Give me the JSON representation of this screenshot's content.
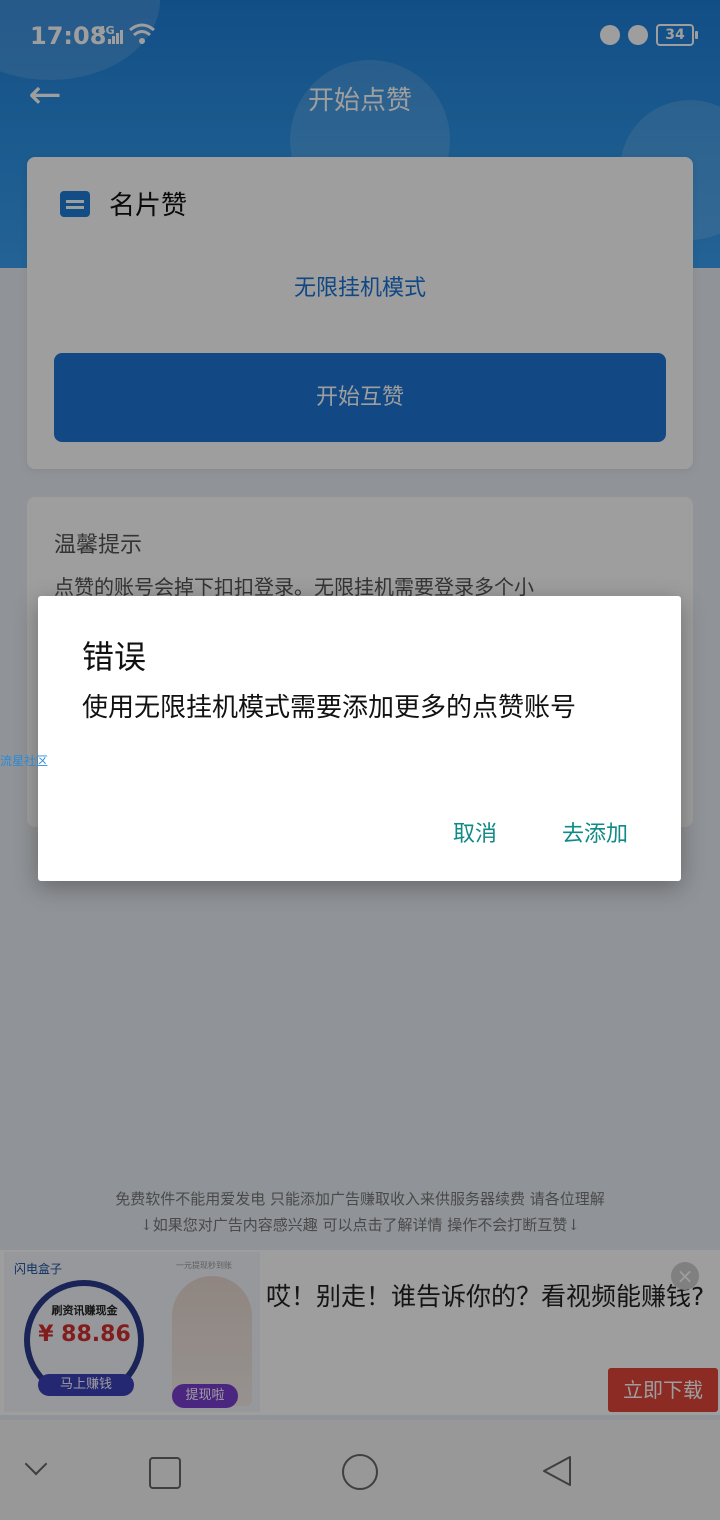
{
  "status_bar": {
    "time": "17:08",
    "network": "4G",
    "battery": "34"
  },
  "header": {
    "title": "开始点赞"
  },
  "card": {
    "title": "名片赞",
    "mode": "无限挂机模式",
    "start_button": "开始互赞"
  },
  "tips": {
    "title": "温馨提示",
    "text": "点赞的账号会掉下扣扣登录。无限挂机需要登录多个小"
  },
  "watermark": "流星社区",
  "footer_note": {
    "line1": "免费软件不能用爱发电 只能添加广告赚取收入来供服务器续费 请各位理解",
    "line2": "↓如果您对广告内容感兴趣 可以点击了解详情 操作不会打断互赞↓"
  },
  "ad": {
    "brand": "闪电盒子",
    "sub": "一元提现秒到账",
    "gauge_label": "刷资讯赚现金",
    "gauge_value": "¥ 88.86",
    "cta_pill": "马上赚钱",
    "person_button": "提现啦",
    "headline": "哎！别走！谁告诉你的？看视频能赚钱?",
    "download_button": "立即下载",
    "close": "×"
  },
  "dialog": {
    "title": "错误",
    "message": "使用无限挂机模式需要添加更多的点赞账号",
    "cancel": "取消",
    "confirm": "去添加"
  },
  "colors": {
    "primary": "#1d77d6",
    "dialog_button": "#0f8a86",
    "ad_download": "#e0463b"
  }
}
